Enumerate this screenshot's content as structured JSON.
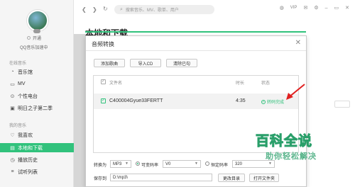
{
  "sidebar": {
    "user_status": "开通",
    "qq_status": "QQ音乐加速中",
    "online_title": "在线音乐",
    "online_items": [
      {
        "label": "音乐馆",
        "icon": "music-hall-icon"
      },
      {
        "label": "MV",
        "icon": "mv-icon"
      },
      {
        "label": "个性电台",
        "icon": "radio-icon"
      },
      {
        "label": "明日之子第二季",
        "icon": "tv-icon"
      }
    ],
    "my_title": "我的音乐",
    "my_items": [
      {
        "label": "我喜欢",
        "icon": "heart-icon"
      },
      {
        "label": "本地和下载",
        "icon": "download-icon",
        "active": true
      },
      {
        "label": "播放历史",
        "icon": "history-icon"
      },
      {
        "label": "试听列表",
        "icon": "playlist-icon"
      }
    ]
  },
  "topbar": {
    "search_placeholder": "搜索音乐、MV、歌单、用户",
    "vip_label": "VIP"
  },
  "main": {
    "title": "本地和下载"
  },
  "dialog": {
    "title": "音频转换",
    "buttons": {
      "add": "添加歌曲",
      "import_cd": "导入CD",
      "clear": "清除已勾"
    },
    "table": {
      "col_filename": "文件名",
      "col_duration": "时长",
      "col_status": "状态",
      "rows": [
        {
          "filename": "C400004Gyue33FERTT",
          "duration": "4:35",
          "status": "转码完成"
        }
      ]
    },
    "convert_label": "转换为",
    "format": "MP3",
    "bitrate_variable_label": "可变码率",
    "bitrate_variable_value": "V0",
    "bitrate_constant_label": "恒定码率",
    "bitrate_constant_value": "320",
    "save_label": "保存到",
    "save_path": "D:\\mp3\\",
    "change_dir": "更改目录",
    "open_folder": "打开文件夹"
  },
  "watermark": {
    "main": "百科全说",
    "sub": "助你轻松解决"
  },
  "colors": {
    "accent": "#31c27c",
    "arrow": "#e02020"
  }
}
